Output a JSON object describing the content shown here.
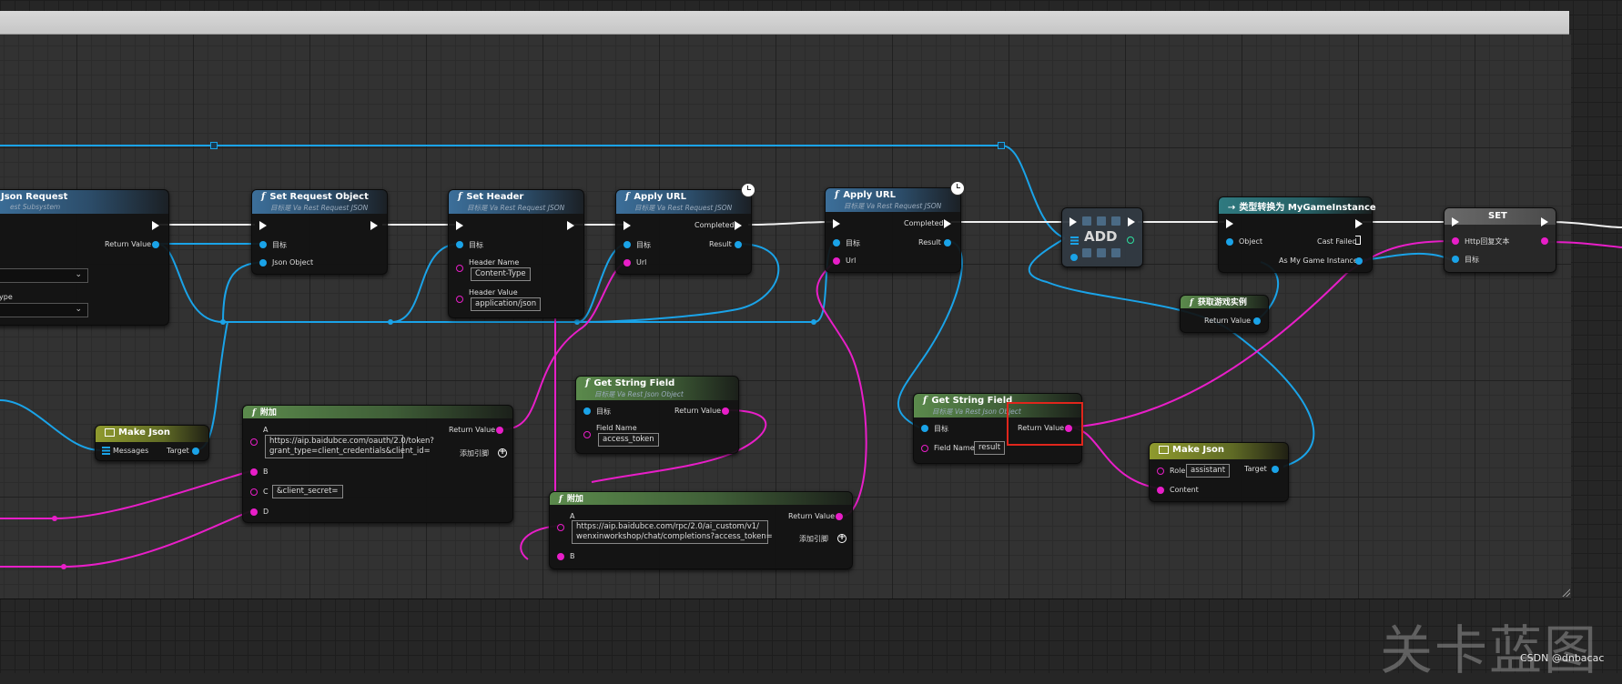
{
  "watermark": "关卡蓝图",
  "credit": "CSDN @dnbacac",
  "nodes": {
    "create_json_request": {
      "title": "Json Request",
      "subtitle": "est Subsystem",
      "return_label": "Return Value",
      "ype_label": "ype"
    },
    "set_request_object": {
      "title": "Set Request Object",
      "subtitle": "目标是 Va Rest Request JSON",
      "target_label": "目标",
      "json_object_label": "Json Object"
    },
    "set_header": {
      "title": "Set Header",
      "subtitle": "目标是 Va Rest Request JSON",
      "target_label": "目标",
      "header_name_label": "Header Name",
      "header_name_value": "Content-Type",
      "header_value_label": "Header Value",
      "header_value_value": "application/json"
    },
    "apply_url_1": {
      "title": "Apply URL",
      "subtitle": "目标是 Va Rest Request JSON",
      "completed_label": "Completed",
      "target_label": "目标",
      "result_label": "Result",
      "url_label": "Url"
    },
    "apply_url_2": {
      "title": "Apply URL",
      "subtitle": "目标是 Va Rest Request JSON",
      "completed_label": "Completed",
      "target_label": "目标",
      "result_label": "Result",
      "url_label": "Url"
    },
    "add": {
      "title": "ADD"
    },
    "cast": {
      "title": "类型转换为 MyGameInstance",
      "object_label": "Object",
      "cast_failed_label": "Cast Failed",
      "as_label": "As My Game Instance"
    },
    "set": {
      "title": "SET",
      "http_label": "Http回复文本",
      "target_label": "目标"
    },
    "get_game_instance": {
      "title": "获取游戏实例",
      "return_label": "Return Value"
    },
    "make_json_1": {
      "title": "Make Json",
      "messages_label": "Messages",
      "target_label": "Target"
    },
    "append_1": {
      "title": "附加",
      "a_label": "A",
      "a_value_line1": "https://aip.baidubce.com/oauth/2.0/token?",
      "a_value_line2": "grant_type=client_credentials&client_id=",
      "b_label": "B",
      "c_label": "C",
      "c_value": "&client_secret=",
      "d_label": "D",
      "return_label": "Return Value",
      "add_pin_label": "添加引脚"
    },
    "get_string_field_1": {
      "title": "Get String Field",
      "subtitle": "目标是 Va Rest Json Object",
      "target_label": "目标",
      "return_label": "Return Value",
      "field_name_label": "Field Name",
      "field_name_value": "access_token"
    },
    "append_2": {
      "title": "附加",
      "a_label": "A",
      "a_value_line1": "https://aip.baidubce.com/rpc/2.0/ai_custom/v1/",
      "a_value_line2": "wenxinworkshop/chat/completions?access_token=",
      "b_label": "B",
      "return_label": "Return Value",
      "add_pin_label": "添加引脚"
    },
    "get_string_field_2": {
      "title": "Get String Field",
      "subtitle": "目标是 Va Rest Json Object",
      "target_label": "目标",
      "return_label": "Return Value",
      "field_name_label": "Field Name",
      "field_name_value": "result"
    },
    "make_json_2": {
      "title": "Make Json",
      "role_label": "Role",
      "role_value": "assistant",
      "content_label": "Content",
      "target_label": "Target"
    }
  }
}
